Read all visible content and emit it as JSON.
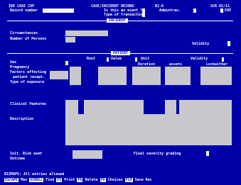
{
  "header": {
    "program_id": "IDE CASE CXP",
    "record_number_label": "Record number",
    "screen_title": "CASE/INCIDENT RECORD",
    "version": "R2.0",
    "page_indicator": "SCR 02/11",
    "is_adverse_event_q": "Is this an event ?",
    "type_of_transaction": "Type of Transaction",
    "admin_label": "Admintrav.",
    "exp_label": "EXP"
  },
  "sections": {
    "incident": "INCIDENT",
    "patient": "PATIENT"
  },
  "incident": {
    "circumstances_label": "Circumstances",
    "number_of_persons_label": "Number of Persons",
    "validity_label": "Validity"
  },
  "patient": {
    "columns": [
      "Rout",
      "Value",
      "Unit",
      "Validity"
    ],
    "subcolumns": [
      "Duration",
      "assets",
      "Lockwither"
    ],
    "rows": [
      "Sex",
      "Pregnancy",
      "Factors affecting",
      "patient recept.",
      "Type of exposure"
    ],
    "clinical_features_label": "Clinical features",
    "description_label": "Description"
  },
  "footer": {
    "initial_risk_label": "Init. Risk asmt",
    "outcome_label": "Outcome",
    "final_severity_label": "Final severity grading"
  },
  "status": {
    "message": "BIZMAPS: All entries allowed",
    "fkeys": [
      {
        "key": "ESCAPE",
        "label": "Men"
      },
      {
        "key": "SCROLL",
        "label": "Find"
      },
      {
        "key": "F5",
        "label": "Print"
      },
      {
        "key": "F6",
        "label": "Delete"
      },
      {
        "key": "F9",
        "label": "Choices"
      },
      {
        "key": "F10",
        "label": "Save"
      },
      {
        "key": "",
        "label": "Rec"
      }
    ]
  }
}
